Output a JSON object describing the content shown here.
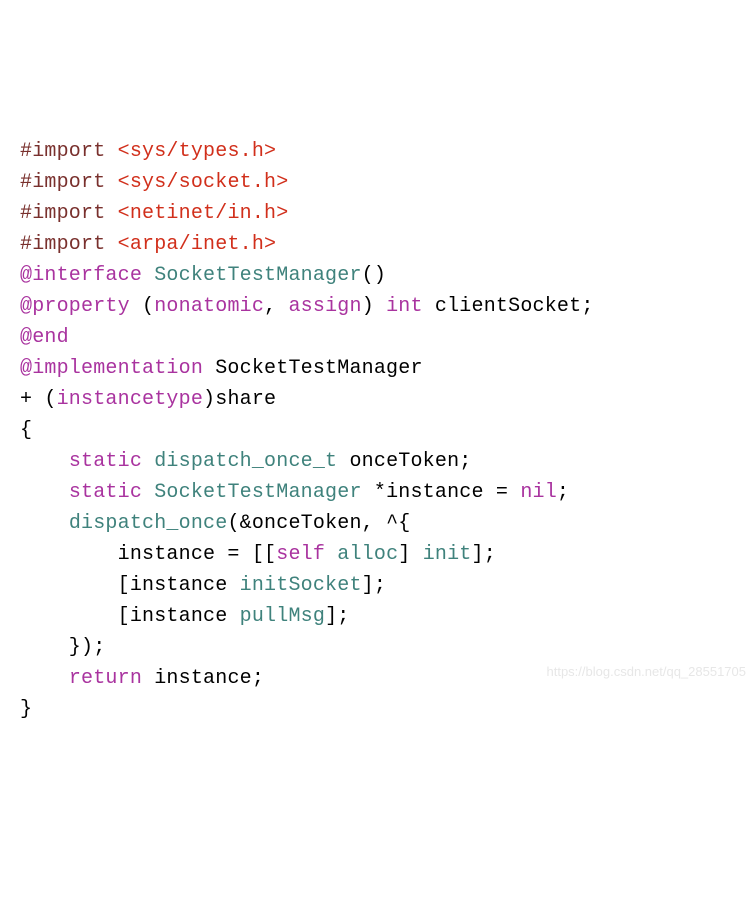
{
  "code": {
    "lines": [
      [
        {
          "cls": "tok-preproc",
          "t": "#import"
        },
        {
          "cls": "tok-plain",
          "t": " "
        },
        {
          "cls": "tok-header",
          "t": "<sys/types.h>"
        }
      ],
      [
        {
          "cls": "tok-preproc",
          "t": "#import"
        },
        {
          "cls": "tok-plain",
          "t": " "
        },
        {
          "cls": "tok-header",
          "t": "<sys/socket.h>"
        }
      ],
      [
        {
          "cls": "tok-preproc",
          "t": "#import"
        },
        {
          "cls": "tok-plain",
          "t": " "
        },
        {
          "cls": "tok-header",
          "t": "<netinet/in.h>"
        }
      ],
      [
        {
          "cls": "tok-preproc",
          "t": "#import"
        },
        {
          "cls": "tok-plain",
          "t": " "
        },
        {
          "cls": "tok-header",
          "t": "<arpa/inet.h>"
        }
      ],
      [
        {
          "cls": "tok-keyword",
          "t": "@interface"
        },
        {
          "cls": "tok-plain",
          "t": " "
        },
        {
          "cls": "tok-type",
          "t": "SocketTestManager"
        },
        {
          "cls": "tok-plain",
          "t": "()"
        }
      ],
      [
        {
          "cls": "tok-plain",
          "t": ""
        }
      ],
      [
        {
          "cls": "tok-keyword",
          "t": "@property"
        },
        {
          "cls": "tok-plain",
          "t": " ("
        },
        {
          "cls": "tok-keyword",
          "t": "nonatomic"
        },
        {
          "cls": "tok-plain",
          "t": ", "
        },
        {
          "cls": "tok-keyword",
          "t": "assign"
        },
        {
          "cls": "tok-plain",
          "t": ") "
        },
        {
          "cls": "tok-keyword",
          "t": "int"
        },
        {
          "cls": "tok-plain",
          "t": " clientSocket;"
        }
      ],
      [
        {
          "cls": "tok-keyword",
          "t": "@end"
        }
      ],
      [
        {
          "cls": "tok-keyword",
          "t": "@implementation"
        },
        {
          "cls": "tok-plain",
          "t": " SocketTestManager"
        }
      ],
      [
        {
          "cls": "tok-plain",
          "t": ""
        }
      ],
      [
        {
          "cls": "tok-plain",
          "t": "+ ("
        },
        {
          "cls": "tok-keyword",
          "t": "instancetype"
        },
        {
          "cls": "tok-plain",
          "t": ")share"
        }
      ],
      [
        {
          "cls": "tok-plain",
          "t": "{"
        }
      ],
      [
        {
          "cls": "tok-plain",
          "t": "    "
        },
        {
          "cls": "tok-keyword",
          "t": "static"
        },
        {
          "cls": "tok-plain",
          "t": " "
        },
        {
          "cls": "tok-type",
          "t": "dispatch_once_t"
        },
        {
          "cls": "tok-plain",
          "t": " onceToken;"
        }
      ],
      [
        {
          "cls": "tok-plain",
          "t": "    "
        },
        {
          "cls": "tok-keyword",
          "t": "static"
        },
        {
          "cls": "tok-plain",
          "t": " "
        },
        {
          "cls": "tok-type",
          "t": "SocketTestManager"
        },
        {
          "cls": "tok-plain",
          "t": " *instance = "
        },
        {
          "cls": "tok-keyword",
          "t": "nil"
        },
        {
          "cls": "tok-plain",
          "t": ";"
        }
      ],
      [
        {
          "cls": "tok-plain",
          "t": "    "
        },
        {
          "cls": "tok-type",
          "t": "dispatch_once"
        },
        {
          "cls": "tok-plain",
          "t": "(&onceToken, ^{"
        }
      ],
      [
        {
          "cls": "tok-plain",
          "t": "        instance = [["
        },
        {
          "cls": "tok-keyword",
          "t": "self"
        },
        {
          "cls": "tok-plain",
          "t": " "
        },
        {
          "cls": "tok-method",
          "t": "alloc"
        },
        {
          "cls": "tok-plain",
          "t": "] "
        },
        {
          "cls": "tok-method",
          "t": "init"
        },
        {
          "cls": "tok-plain",
          "t": "];"
        }
      ],
      [
        {
          "cls": "tok-plain",
          "t": "        [instance "
        },
        {
          "cls": "tok-method",
          "t": "initSocket"
        },
        {
          "cls": "tok-plain",
          "t": "];"
        }
      ],
      [
        {
          "cls": "tok-plain",
          "t": "        [instance "
        },
        {
          "cls": "tok-method",
          "t": "pullMsg"
        },
        {
          "cls": "tok-plain",
          "t": "];"
        }
      ],
      [
        {
          "cls": "tok-plain",
          "t": "    });"
        }
      ],
      [
        {
          "cls": "tok-plain",
          "t": "    "
        },
        {
          "cls": "tok-keyword",
          "t": "return"
        },
        {
          "cls": "tok-plain",
          "t": " instance;"
        }
      ],
      [
        {
          "cls": "tok-plain",
          "t": "}"
        }
      ]
    ]
  },
  "watermark": "https://blog.csdn.net/qq_28551705"
}
